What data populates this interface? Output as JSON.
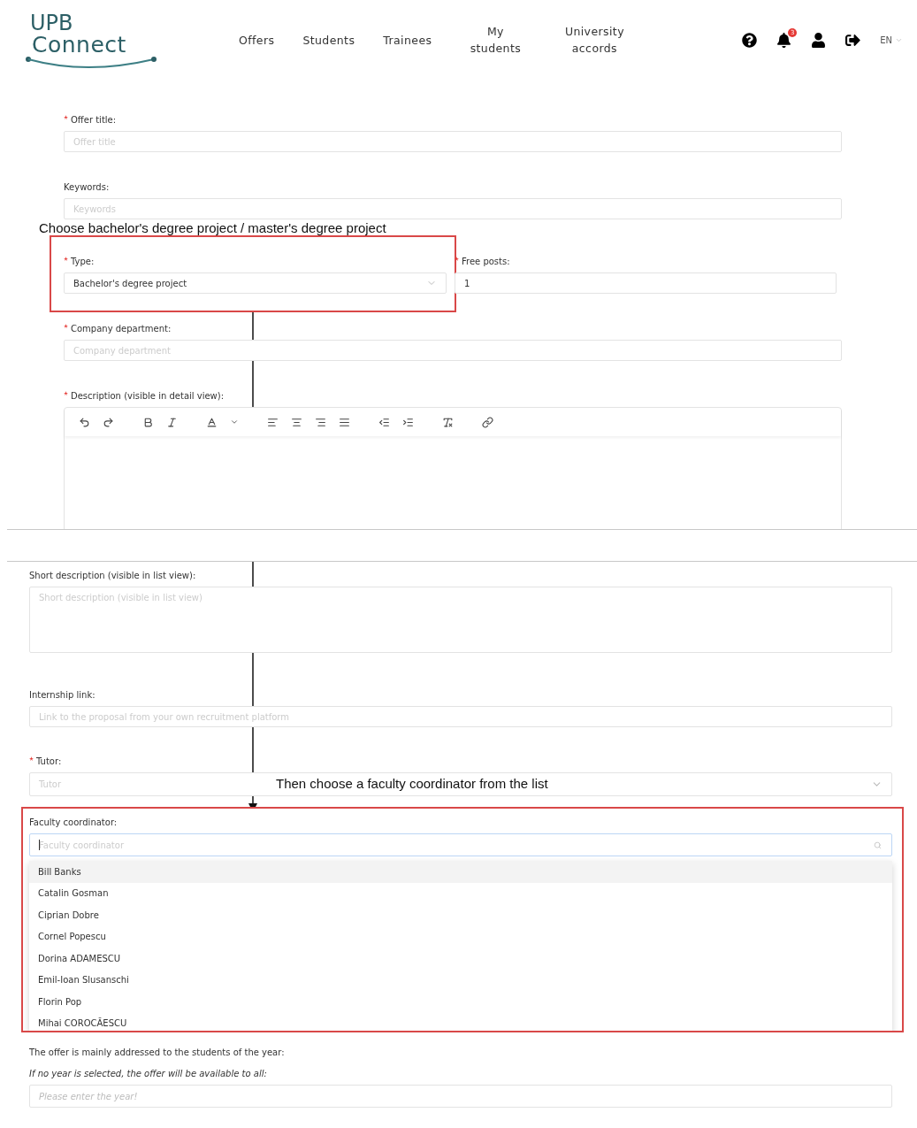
{
  "header": {
    "logo": {
      "line_1": "UPB",
      "line_2": "Connect"
    },
    "nav": [
      {
        "label": "Offers"
      },
      {
        "label": "Students"
      },
      {
        "label": "Trainees"
      },
      {
        "label": "My students"
      },
      {
        "label": "University accords"
      }
    ],
    "notification_count": "3",
    "language": "EN"
  },
  "top_form": {
    "fields": [
      {
        "kind": "input",
        "label": "Offer title:",
        "required": true,
        "placeholder": "Offer title"
      },
      {
        "kind": "input",
        "label": "Keywords:",
        "required": false,
        "placeholder": "Keywords"
      }
    ],
    "type_field": {
      "label": "Type:",
      "required": true,
      "value": "Bachelor's degree project"
    },
    "free_posts": {
      "label": "Free posts:",
      "required": true,
      "value": "1"
    },
    "fields_after": [
      {
        "kind": "input",
        "label": "Company department:",
        "required": true,
        "placeholder": "Company department"
      },
      {
        "kind": "editor",
        "label": "Description (visible in detail view):",
        "required": true
      }
    ]
  },
  "bottom_form": {
    "fields": [
      {
        "kind": "textarea",
        "label": "Short description (visible in list view):",
        "required": false,
        "placeholder": "Short description (visible in list view)"
      },
      {
        "kind": "input",
        "label": "Internship link:",
        "required": false,
        "placeholder": "Link to the proposal from your own recruitment platform"
      },
      {
        "kind": "select",
        "label": "Tutor:",
        "required": true,
        "placeholder": "Tutor"
      }
    ],
    "coordinator": {
      "label": "Faculty coordinator:",
      "placeholder": "Faculty coordinator",
      "options": [
        {
          "name": "Bill Banks",
          "selected": true
        },
        {
          "name": "Catalin Gosman",
          "selected": false
        },
        {
          "name": "Ciprian Dobre",
          "selected": false
        },
        {
          "name": "Cornel Popescu",
          "selected": false
        },
        {
          "name": "Dorina ADAMESCU",
          "selected": false
        },
        {
          "name": "Emil-Ioan Slusanschi",
          "selected": false
        },
        {
          "name": "Florin Pop",
          "selected": false
        },
        {
          "name": "Mihai COROCĂESCU",
          "selected": false
        }
      ]
    },
    "year": {
      "label": "The offer is mainly addressed to the students of the year:",
      "hint": "If no year is selected, the offer will be available to all:",
      "placeholder": "Please enter the year!"
    }
  },
  "annotations": [
    {
      "text": "Choose bachelor's degree project / master's degree project"
    },
    {
      "text": "Then choose a faculty coordinator from the list"
    }
  ]
}
